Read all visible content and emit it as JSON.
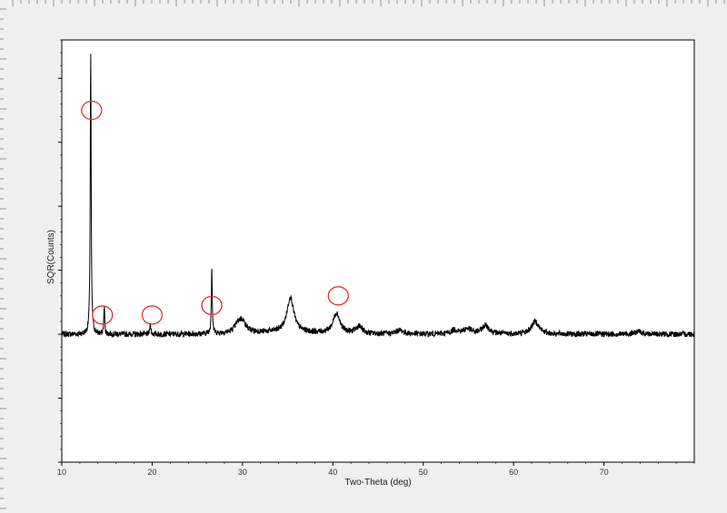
{
  "chart_data": {
    "type": "line",
    "title": "",
    "xlabel": "Two-Theta (deg)",
    "ylabel": "SQR(Counts)",
    "xlim": [
      10,
      80
    ],
    "ylim": [
      -20,
      46
    ],
    "xticks": [
      10,
      20,
      30,
      40,
      50,
      60,
      70
    ],
    "grid": false,
    "legend": "none",
    "baseline": 0,
    "line_color": "#000000",
    "marker_color": "#e8302a",
    "series": [
      {
        "peaks": [
          {
            "x": 13.2,
            "height": 44
          },
          {
            "x": 14.7,
            "height": 4.2
          },
          {
            "x": 19.8,
            "height": 1.8
          },
          {
            "x": 26.6,
            "height": 10.5
          },
          {
            "x": 29.5,
            "height": 1.2
          },
          {
            "x": 30.0,
            "height": 1.6
          },
          {
            "x": 35.3,
            "height": 5.5
          },
          {
            "x": 40.4,
            "height": 3.2
          },
          {
            "x": 42.9,
            "height": 1.1
          },
          {
            "x": 47.4,
            "height": 0.6
          },
          {
            "x": 53.5,
            "height": 0.6
          },
          {
            "x": 54.9,
            "height": 0.8
          },
          {
            "x": 56.9,
            "height": 1.3
          },
          {
            "x": 62.4,
            "height": 2.0
          },
          {
            "x": 73.8,
            "height": 0.4
          }
        ]
      }
    ],
    "marked_peaks": [
      {
        "x": 13.3,
        "y": 35
      },
      {
        "x": 14.5,
        "y": 3
      },
      {
        "x": 20.0,
        "y": 3
      },
      {
        "x": 26.6,
        "y": 4.5
      },
      {
        "x": 40.6,
        "y": 6
      }
    ]
  }
}
